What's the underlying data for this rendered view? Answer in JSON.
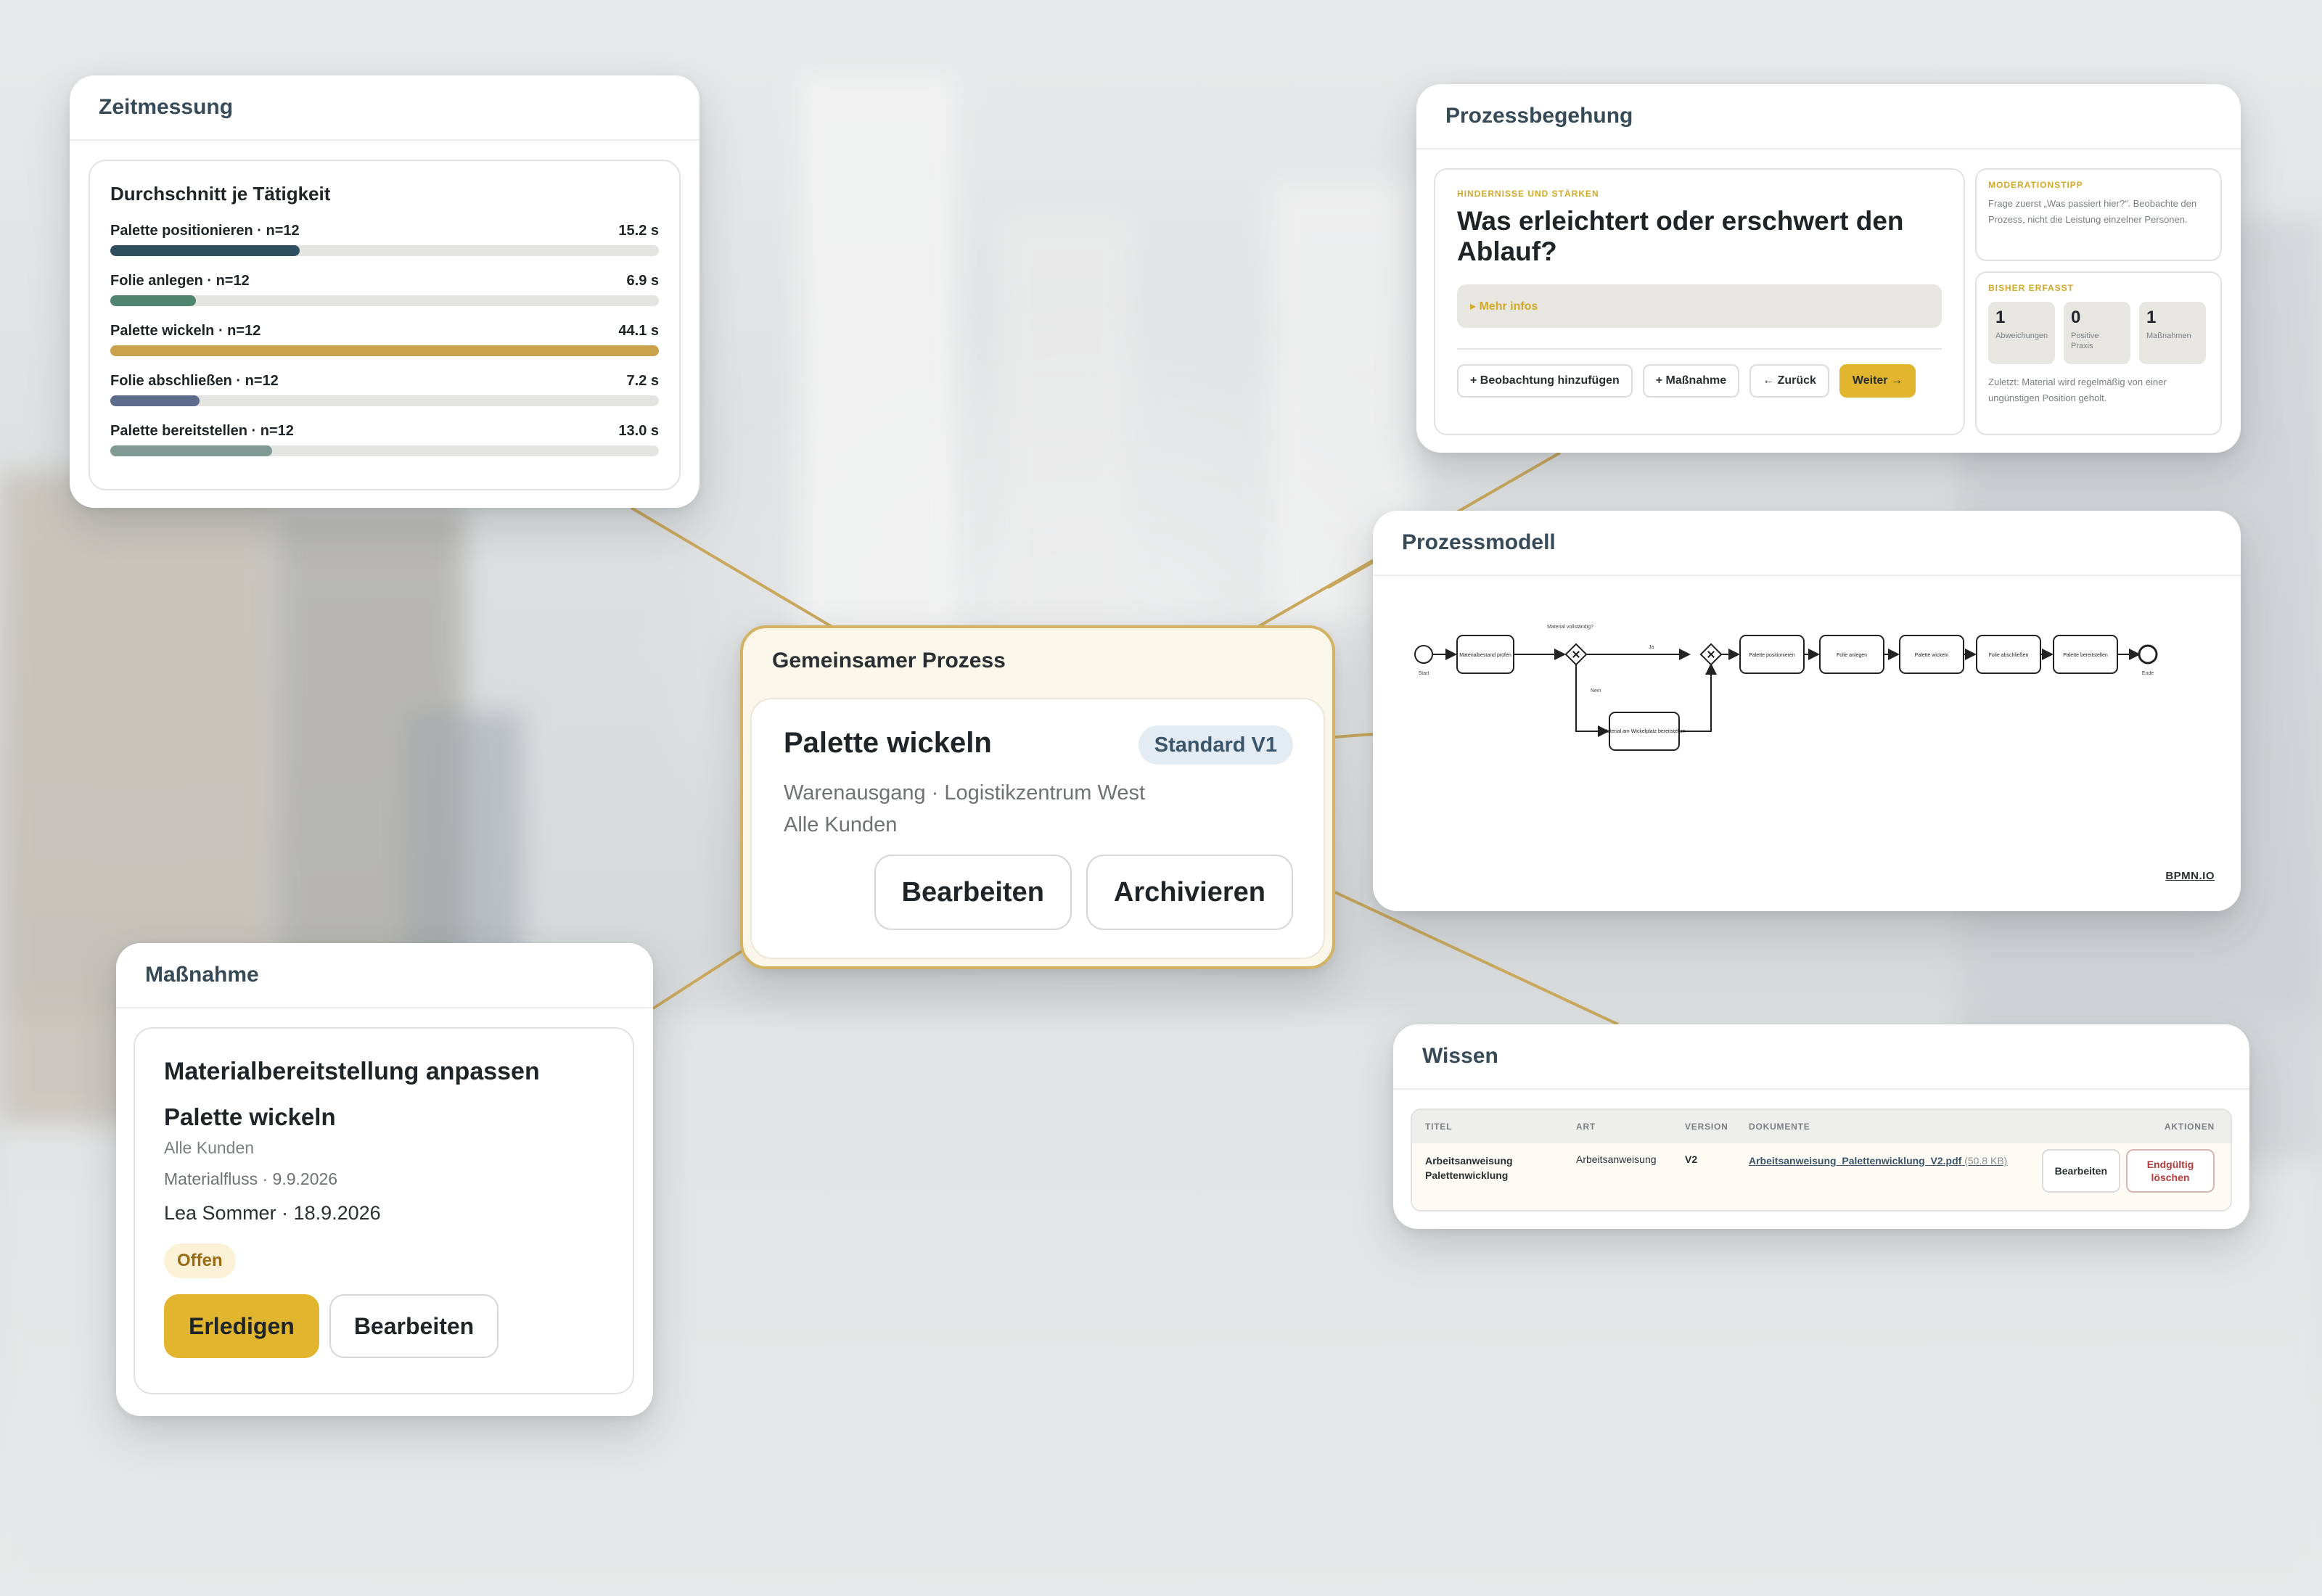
{
  "zeitmessung": {
    "header": "Zeitmessung",
    "subtitle": "Durchschnitt je Tätigkeit",
    "activities": [
      {
        "label": "Palette positionieren · n=12",
        "value": "15.2 s",
        "fraction": 0.345,
        "color": "#2f4e60"
      },
      {
        "label": "Folie anlegen · n=12",
        "value": "6.9 s",
        "fraction": 0.156,
        "color": "#4e8470"
      },
      {
        "label": "Palette wickeln · n=12",
        "value": "44.1 s",
        "fraction": 1.0,
        "color": "#c9a24b"
      },
      {
        "label": "Folie abschließen · n=12",
        "value": "7.2 s",
        "fraction": 0.163,
        "color": "#5d6b8c"
      },
      {
        "label": "Palette bereitstellen · n=12",
        "value": "13.0 s",
        "fraction": 0.295,
        "color": "#7f9a92"
      }
    ]
  },
  "prozessbegehung": {
    "header": "Prozessbegehung",
    "kicker": "HINDERNISSE UND STÄRKEN",
    "question": "Was erleichtert oder erschwert den Ablauf?",
    "mehr_infos": "▸ Mehr infos",
    "buttons": {
      "add_observation": "+ Beobachtung hinzufügen",
      "add_measure": "+ Maßnahme",
      "back": "← Zurück",
      "next": "Weiter →"
    },
    "tip": {
      "kicker": "MODERATIONSTIPP",
      "text": "Frage zuerst „Was passiert hier?“. Beobachte den Prozess, nicht die Leistung einzelner Personen."
    },
    "erfasst": {
      "kicker": "BISHER ERFASST",
      "stats": [
        {
          "n": "1",
          "label": "Abweichungen"
        },
        {
          "n": "0",
          "label": "Positive Praxis"
        },
        {
          "n": "1",
          "label": "Maßnahmen"
        }
      ],
      "last": "Zuletzt: Material wird regelmäßig von einer ungünstigen Position geholt."
    }
  },
  "prozessmodell": {
    "header": "Prozessmodell",
    "start_label": "Start",
    "end_label": "Ende",
    "gateway_question": "Material vollständig?",
    "yes_label": "Ja",
    "no_label": "Nein",
    "task_check": "Materialbestand prüfen",
    "task_supply": "Material am Wickelplatz bereitstellen",
    "tasks": [
      "Palette positionieren",
      "Folie anlegen",
      "Palette wickeln",
      "Folie abschließen",
      "Palette bereitstellen"
    ],
    "watermark": "BPMN.IO"
  },
  "gemeinsam": {
    "header": "Gemeinsamer Prozess",
    "title": "Palette wickeln",
    "badge": "Standard V1",
    "location": "Warenausgang · Logistikzentrum West",
    "customers": "Alle Kunden",
    "edit": "Bearbeiten",
    "archive": "Archivieren"
  },
  "massnahme": {
    "header": "Maßnahme",
    "title": "Materialbereitstellung anpassen",
    "process": "Palette wickeln",
    "customers": "Alle Kunden",
    "category": "Materialfluss · 9.9.2026",
    "owner": "Lea Sommer · 18.9.2026",
    "status": "Offen",
    "done": "Erledigen",
    "edit": "Bearbeiten"
  },
  "wissen": {
    "header": "Wissen",
    "columns": [
      "TITEL",
      "ART",
      "VERSION",
      "DOKUMENTE",
      "AKTIONEN"
    ],
    "row": {
      "title": "Arbeitsanweisung Palettenwicklung",
      "type": "Arbeitsanweisung",
      "version": "V2",
      "document": "Arbeitsanweisung_Palettenwicklung_V2.pdf",
      "size": "(50.8 KB)",
      "edit": "Bearbeiten",
      "delete": "Endgültig löschen"
    }
  },
  "colors": {
    "accent": "#e1b52e",
    "link_line": "#c9a85c",
    "heading": "#364a57"
  }
}
